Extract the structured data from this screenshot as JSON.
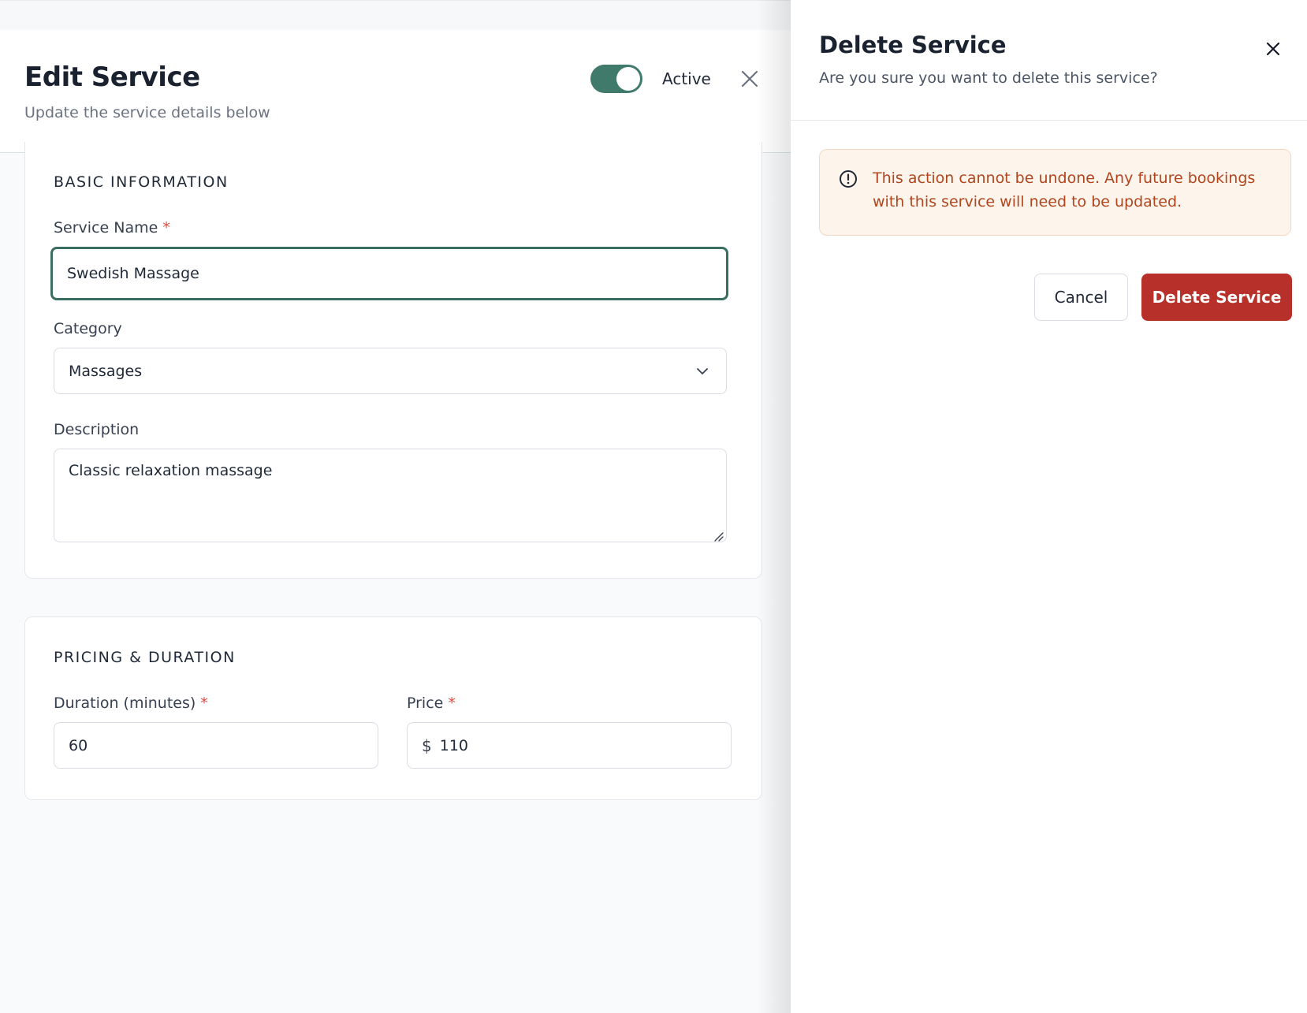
{
  "edit_service": {
    "title": "Edit Service",
    "subtitle": "Update the service details below",
    "active_label": "Active",
    "active": true,
    "close_icon": "close-icon"
  },
  "basic_information": {
    "title": "BASIC INFORMATION",
    "service_name_label": "Service Name",
    "required_mark": "*",
    "service_name_value": "Swedish Massage",
    "category_label": "Category",
    "category_value": "Massages",
    "description_label": "Description",
    "description_value": "Classic relaxation massage"
  },
  "pricing_duration": {
    "title": "PRICING & DURATION",
    "duration_label": "Duration (minutes)",
    "duration_value": "60",
    "price_label": "Price",
    "currency_symbol": "$",
    "price_value": "110"
  },
  "delete_panel": {
    "title": "Delete Service",
    "subtitle": "Are you sure you want to delete this service?",
    "warning": "This action cannot be undone. Any future bookings with this service will need to be updated.",
    "cancel_label": "Cancel",
    "delete_label": "Delete Service"
  },
  "colors": {
    "accent": "#3f7a6a",
    "danger": "#b8302a",
    "warning_bg": "#fdf4ec",
    "warning_text": "#b1461e"
  }
}
